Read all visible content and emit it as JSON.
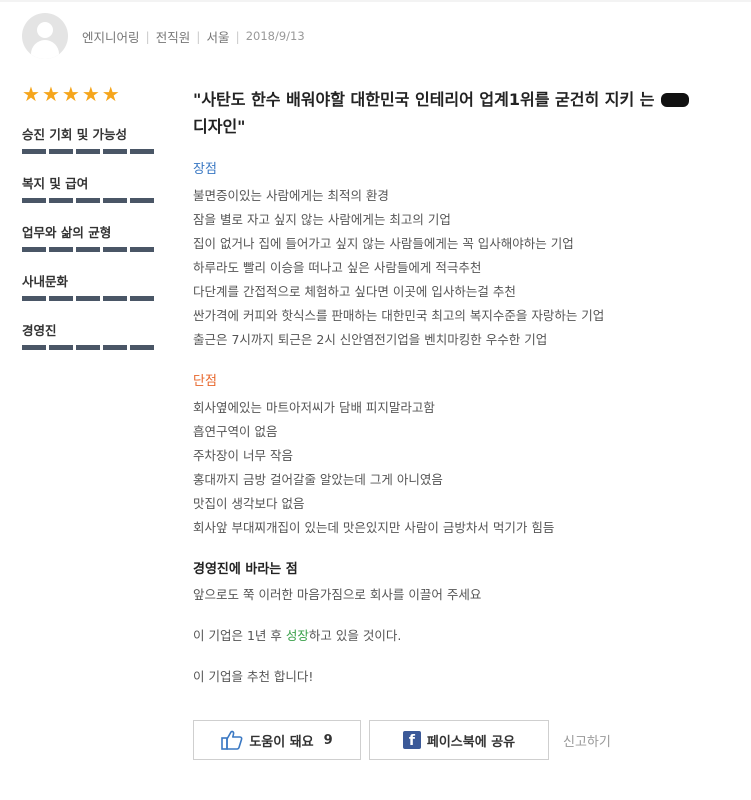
{
  "author": {
    "job": "엔지니어링",
    "status": "전직원",
    "location": "서울",
    "date": "2018/9/13"
  },
  "rating": {
    "stars": 5,
    "star_color": "#f5a51c"
  },
  "categories": [
    {
      "label": "승진 기회 및 가능성"
    },
    {
      "label": "복지 및 급여"
    },
    {
      "label": "업무와 삶의 균형"
    },
    {
      "label": "사내문화"
    },
    {
      "label": "경영진"
    }
  ],
  "review": {
    "title_part1": "\"사탄도 한수 배워야할 대한민국 인테리어 업계1위를 굳건히 지키",
    "title_part2_pre": "는 ",
    "title_part2_post": "디자인\"",
    "pros_heading": "장점",
    "pros": [
      "불면증이있는 사람에게는 최적의 환경",
      "잠을 별로 자고 싶지 않는 사람에게는 최고의 기업",
      "집이 없거나 집에 들어가고 싶지 않는 사람들에게는 꼭 입사해야하는 기업",
      "하루라도 빨리 이승을 떠나고 싶은 사람들에게 적극추천",
      "다단계를 간접적으로 체험하고 싶다면 이곳에 입사하는걸 추천",
      "싼가격에 커피와 핫식스를 판매하는 대한민국 최고의 복지수준을 자랑하는 기업",
      "출근은 7시까지 퇴근은 2시 신안염전기업을 벤치마킹한 우수한 기업"
    ],
    "cons_heading": "단점",
    "cons": [
      "회사옆에있는 마트아저씨가 담배 피지말라고함",
      "흡연구역이 없음",
      "주차장이 너무 작음",
      "홍대까지 금방 걸어갈줄 알았는데 그게 아니였음",
      "맛집이 생각보다 없음",
      "회사앞 부대찌개집이 있는데 맛은있지만 사람이 금방차서 먹기가 힘듬"
    ],
    "advice_heading": "경영진에 바라는 점",
    "advice": "앞으로도 쭉 이러한 마음가짐으로 회사를 이끌어 주세요",
    "outlook_pre": "이 기업은 1년 후 ",
    "outlook_highlight": "성장",
    "outlook_post": "하고 있을 것이다.",
    "recommend": "이 기업을 추천 합니다!"
  },
  "actions": {
    "helpful_label": "도움이 돼요",
    "helpful_count": "9",
    "share_label": "페이스북에 공유",
    "report_label": "신고하기"
  },
  "colors": {
    "pros_heading": "#3a78c3",
    "cons_heading": "#e8672c",
    "growth": "#3aa04a",
    "rating_bar": "#4a5666",
    "facebook": "#3b5998"
  }
}
